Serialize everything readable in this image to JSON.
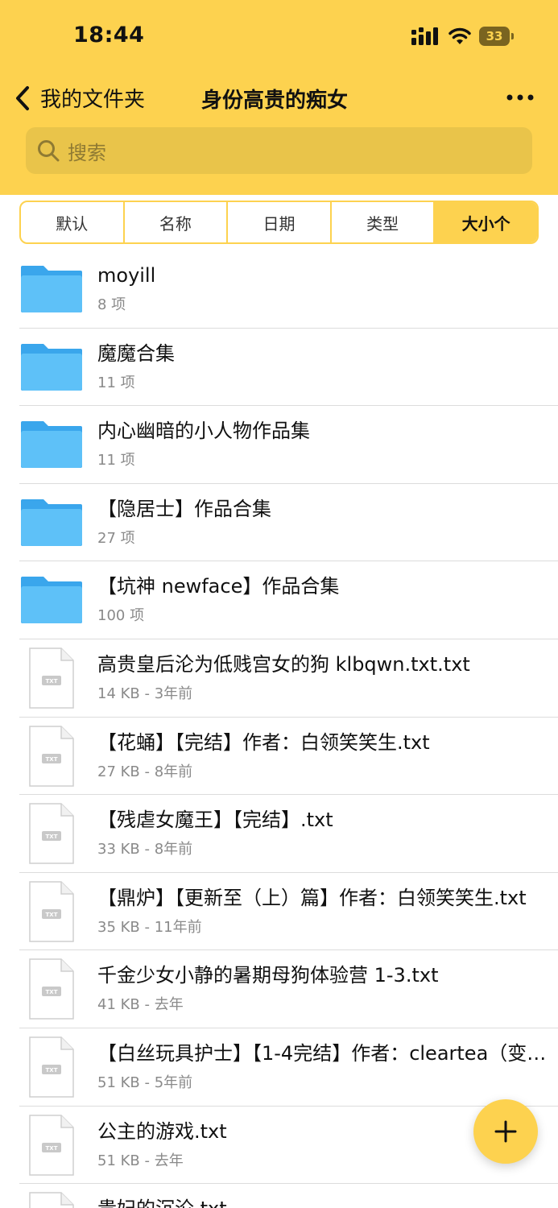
{
  "status": {
    "time": "18:44",
    "battery": "33"
  },
  "nav": {
    "back_label": "我的文件夹",
    "title": "身份高贵的痴女"
  },
  "search": {
    "placeholder": "搜索"
  },
  "sort_tabs": [
    {
      "label": "默认",
      "active": false
    },
    {
      "label": "名称",
      "active": false
    },
    {
      "label": "日期",
      "active": false
    },
    {
      "label": "类型",
      "active": false
    },
    {
      "label": "大小个",
      "active": true
    }
  ],
  "items": [
    {
      "type": "folder",
      "name": "moyill",
      "meta": "8 项"
    },
    {
      "type": "folder",
      "name": "魔魔合集",
      "meta": "11 项"
    },
    {
      "type": "folder",
      "name": "内心幽暗的小人物作品集",
      "meta": "11 项"
    },
    {
      "type": "folder",
      "name": "【隐居士】作品合集",
      "meta": "27 项"
    },
    {
      "type": "folder",
      "name": "【坑神 newface】作品合集",
      "meta": "100 项"
    },
    {
      "type": "file",
      "name": "高贵皇后沦为低贱宫女的狗 klbqwn.txt.txt",
      "meta": "14 KB - 3年前"
    },
    {
      "type": "file",
      "name": "【花蛹】【完结】作者：白领笑笑生.txt",
      "meta": "27 KB - 8年前"
    },
    {
      "type": "file",
      "name": "【残虐女魔王】【完结】.txt",
      "meta": "33 KB - 8年前"
    },
    {
      "type": "file",
      "name": "【鼎炉】【更新至（上）篇】作者：白领笑笑生.txt",
      "meta": "35 KB - 11年前"
    },
    {
      "type": "file",
      "name": "千金少女小静的暑期母狗体验营 1-3.txt",
      "meta": "41 KB - 去年"
    },
    {
      "type": "file",
      "name": "【白丝玩具护士】【1-4完结】作者：cleartea（变…",
      "meta": "51 KB - 5年前"
    },
    {
      "type": "file",
      "name": "公主的游戏.txt",
      "meta": "51 KB - 去年"
    },
    {
      "type": "file",
      "name": "贵妃的沉沦.txt",
      "meta": ""
    }
  ],
  "file_badge": "TXT",
  "colors": {
    "accent": "#fdd24f",
    "folder": "#4fb3f5"
  }
}
